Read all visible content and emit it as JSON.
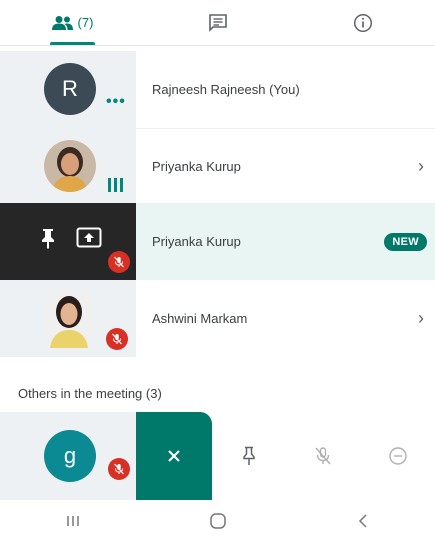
{
  "tabs": {
    "people_count": "(7)",
    "people_icon": "people-icon",
    "chat_icon": "chat-icon",
    "info_icon": "info-icon"
  },
  "participants": [
    {
      "initial": "R",
      "name": "Rajneesh Rajneesh (You)",
      "status_icon": "more-dots-icon"
    },
    {
      "name": "Priyanka Kurup",
      "status_icon": "audio-level-icon",
      "chevron": "›"
    },
    {
      "name": "Priyanka Kurup",
      "badge": "NEW",
      "status_icon": "mic-off-icon"
    },
    {
      "name": "Ashwini Markam",
      "status_icon": "mic-off-icon",
      "chevron": "›"
    }
  ],
  "others_section": {
    "title": "Others in the meeting (3)"
  },
  "others": [
    {
      "initial": "g"
    }
  ],
  "actions": {
    "close_icon": "close-icon",
    "pin_icon": "pin-icon",
    "mute_icon": "mic-off-icon",
    "remove_icon": "remove-icon"
  },
  "navbar": {
    "recents_icon": "recents-icon",
    "home_icon": "home-icon",
    "back_icon": "back-icon"
  },
  "colors": {
    "accent": "#00796b",
    "highlight_bg": "#e8f5f3",
    "mic_off": "#d93025"
  }
}
